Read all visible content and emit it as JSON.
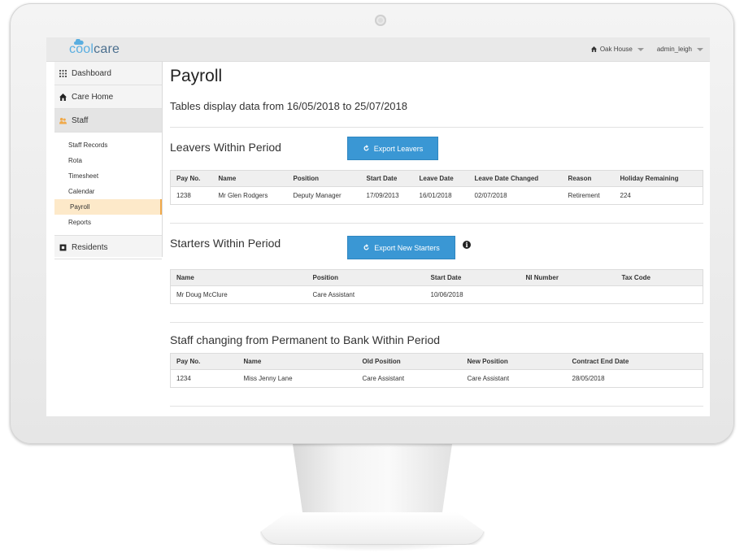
{
  "app": {
    "logo_cool": "cool",
    "logo_care": "care",
    "brand_color": "#5aaee0"
  },
  "topbar": {
    "location": "Oak House",
    "user": "admin_leigh"
  },
  "sidebar": {
    "items": [
      {
        "label": "Dashboard",
        "icon": "grid-icon"
      },
      {
        "label": "Care Home",
        "icon": "home-icon"
      },
      {
        "label": "Staff",
        "icon": "users-icon"
      },
      {
        "label": "Residents",
        "icon": "bed-icon"
      }
    ],
    "staff_sub": [
      "Staff Records",
      "Rota",
      "Timesheet",
      "Calendar",
      "Payroll",
      "Reports"
    ],
    "active_sub": "Payroll"
  },
  "page": {
    "title": "Payroll",
    "date_range": "Tables display data from 16/05/2018 to 25/07/2018"
  },
  "leavers": {
    "title": "Leavers Within Period",
    "button": "Export Leavers",
    "columns": [
      "Pay No.",
      "Name",
      "Position",
      "Start Date",
      "Leave Date",
      "Leave Date Changed",
      "Reason",
      "Holiday Remaining"
    ],
    "rows": [
      [
        "1238",
        "Mr Glen Rodgers",
        "Deputy Manager",
        "17/09/2013",
        "16/01/2018",
        "02/07/2018",
        "Retirement",
        "224"
      ]
    ]
  },
  "starters": {
    "title": "Starters Within Period",
    "button": "Export New Starters",
    "columns": [
      "Name",
      "Position",
      "Start Date",
      "NI Number",
      "Tax Code"
    ],
    "rows": [
      [
        "Mr Doug McClure",
        "Care Assistant",
        "10/06/2018",
        "",
        ""
      ]
    ]
  },
  "changes": {
    "title": "Staff changing from Permanent to Bank Within Period",
    "columns": [
      "Pay No.",
      "Name",
      "Old Position",
      "New Position",
      "Contract End Date"
    ],
    "rows": [
      [
        "1234",
        "Miss Jenny Lane",
        "Care Assistant",
        "Care Assistant",
        "28/05/2018"
      ]
    ]
  }
}
